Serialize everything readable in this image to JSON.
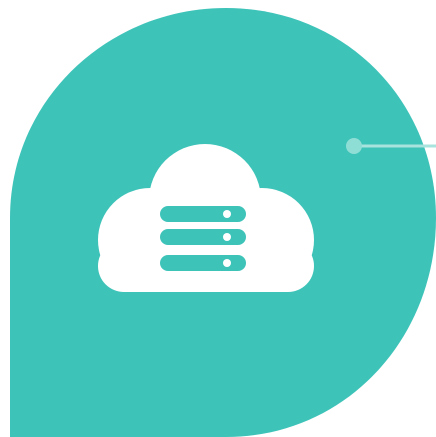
{
  "colors": {
    "background": "#ffffff",
    "shape": "#3ec3b9",
    "cloud": "#ffffff",
    "server_bars": "#3ec3b9",
    "server_leds": "#ffffff",
    "connector_line": "#a8e3dd",
    "connector_dot": "#8fded6"
  },
  "icons": {
    "main": "cloud-server-icon"
  }
}
